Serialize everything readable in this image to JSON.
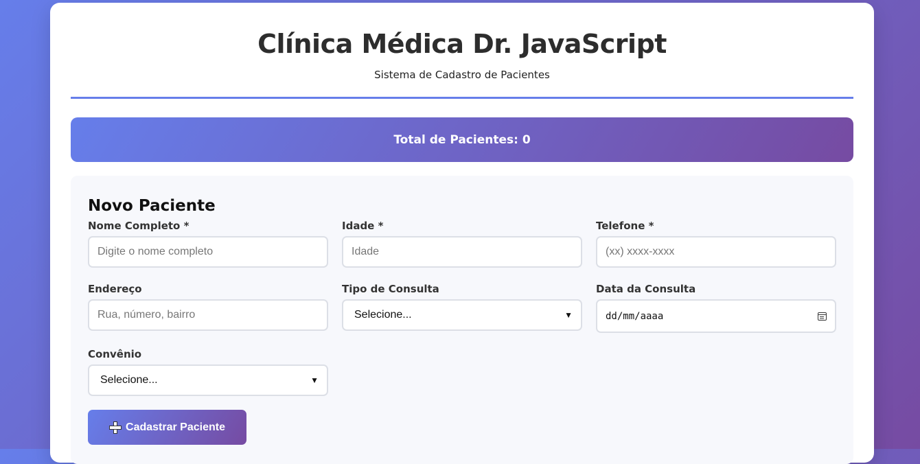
{
  "header": {
    "title": "Clínica Médica Dr. JavaScript",
    "subtitle": "Sistema de Cadastro de Pacientes"
  },
  "stats": {
    "total_label": "Total de Pacientes: 0"
  },
  "form": {
    "title": "Novo Paciente",
    "nome": {
      "label": "Nome Completo *",
      "placeholder": "Digite o nome completo"
    },
    "idade": {
      "label": "Idade *",
      "placeholder": "Idade"
    },
    "telefone": {
      "label": "Telefone *",
      "placeholder": "(xx) xxxx-xxxx"
    },
    "endereco": {
      "label": "Endereço",
      "placeholder": "Rua, número, bairro"
    },
    "tipo_consulta": {
      "label": "Tipo de Consulta",
      "value": "Selecione..."
    },
    "data_consulta": {
      "label": "Data da Consulta",
      "value": "dd/mm/aaaa"
    },
    "convenio": {
      "label": "Convênio",
      "value": "Selecione..."
    },
    "submit_label": "Cadastrar Paciente"
  },
  "icons": {
    "dropdown": "chevron-down-icon",
    "date": "calendar-icon",
    "submit": "plus-icon"
  },
  "colors": {
    "accent": "#667eea",
    "accent_end": "#764ba2"
  }
}
